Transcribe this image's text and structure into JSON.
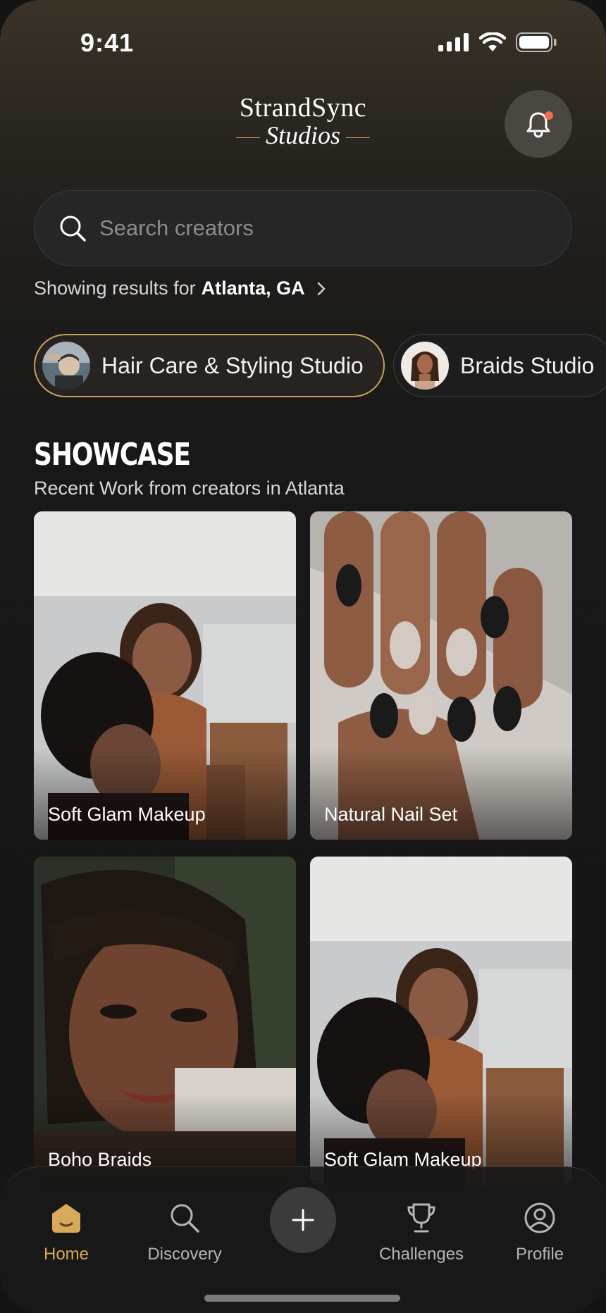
{
  "status_bar": {
    "time": "9:41"
  },
  "brand": {
    "line1": "StrandSync",
    "line2": "Studios"
  },
  "search": {
    "placeholder": "Search creators"
  },
  "location": {
    "prefix": "Showing results for",
    "city": "Atlanta, GA"
  },
  "categories": [
    {
      "label": "Hair Care & Styling Studio",
      "active": true
    },
    {
      "label": "Braids Studio",
      "active": false
    }
  ],
  "showcase": {
    "title": "SHOWCASE",
    "subtitle": "Recent Work from creators in Atlanta",
    "cards": [
      {
        "label": "Soft Glam Makeup"
      },
      {
        "label": "Natural Nail Set"
      },
      {
        "label": "Boho Braids"
      },
      {
        "label": "Soft Glam Makeup"
      }
    ]
  },
  "nav": {
    "items": [
      {
        "label": "Home",
        "icon": "home-icon",
        "active": true
      },
      {
        "label": "Discovery",
        "icon": "search-icon",
        "active": false
      },
      {
        "label": "",
        "icon": "plus-icon",
        "active": false
      },
      {
        "label": "Challenges",
        "icon": "trophy-icon",
        "active": false
      },
      {
        "label": "Profile",
        "icon": "profile-icon",
        "active": false
      }
    ]
  },
  "colors": {
    "accent": "#c9a05a",
    "notification": "#f06a5c",
    "background": "#151515"
  }
}
